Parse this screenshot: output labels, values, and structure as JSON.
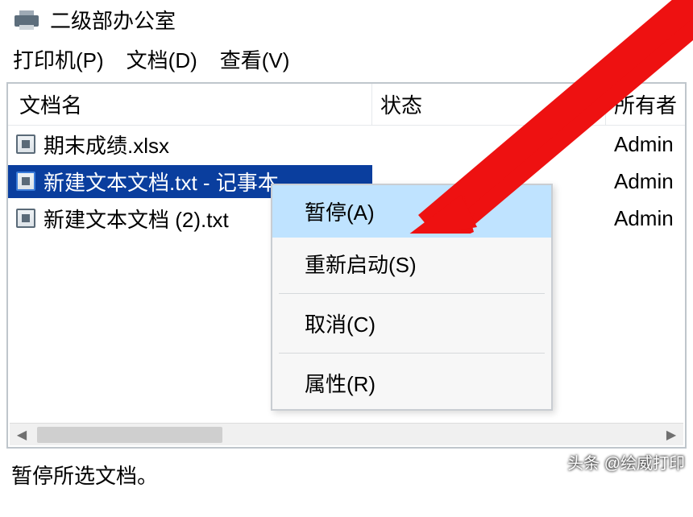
{
  "title": "二级部办公室",
  "menus": {
    "printer": "打印机(P)",
    "document": "文档(D)",
    "view": "查看(V)"
  },
  "columns": {
    "name": "文档名",
    "status": "状态",
    "owner": "所有者"
  },
  "files": [
    {
      "name": "期末成绩.xlsx",
      "owner": "Admin",
      "selected": false
    },
    {
      "name": "新建文本文档.txt - 记事本",
      "owner": "Admin",
      "selected": true
    },
    {
      "name": "新建文本文档 (2).txt",
      "owner": "Admin",
      "selected": false
    }
  ],
  "context": {
    "pause": "暂停(A)",
    "restart": "重新启动(S)",
    "cancel": "取消(C)",
    "properties": "属性(R)"
  },
  "status_text": "暂停所选文档。",
  "watermark": "头条 @绘威打印"
}
